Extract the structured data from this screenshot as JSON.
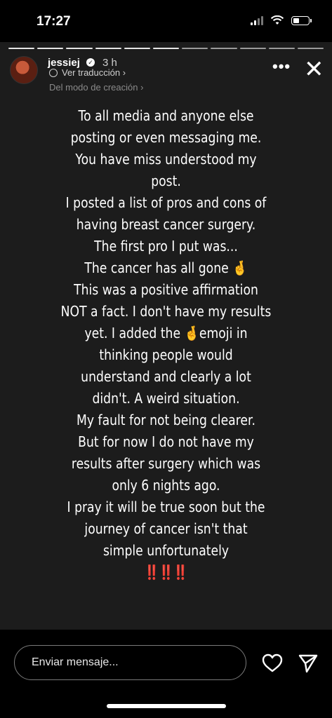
{
  "status": {
    "time": "17:27"
  },
  "header": {
    "username": "jessiej",
    "verified_mark": "✓",
    "time_ago": "3 h",
    "translate_label": "Ver traducción ›",
    "creation_label": "Del modo de creación ›",
    "more_label": "•••",
    "close_label": "✕"
  },
  "story": {
    "lines": [
      "To all media and anyone else",
      "posting or even messaging me.",
      "You have miss understood my",
      "post.",
      "I posted a list of pros and cons of",
      "having breast cancer surgery.",
      "The first pro I put was...",
      "The cancer has all gone 🤞",
      "This was a positive affirmation",
      "NOT a fact. I don't have my results",
      "yet. I added the 🤞emoji in",
      "thinking people would",
      "understand and clearly a lot",
      "didn't. A weird situation.",
      "My fault for not being clearer.",
      "But for now I do not have my",
      "results after surgery which was",
      "only 6 nights ago.",
      "I pray it will be true soon but the",
      "journey of cancer isn't that",
      "simple unfortunately",
      "‼️‼️‼️"
    ]
  },
  "footer": {
    "message_placeholder": "Enviar mensaje..."
  },
  "icons": {
    "heart": "heart-icon",
    "send": "send-icon",
    "verified": "verified-badge-icon",
    "translate": "translate-icon"
  }
}
